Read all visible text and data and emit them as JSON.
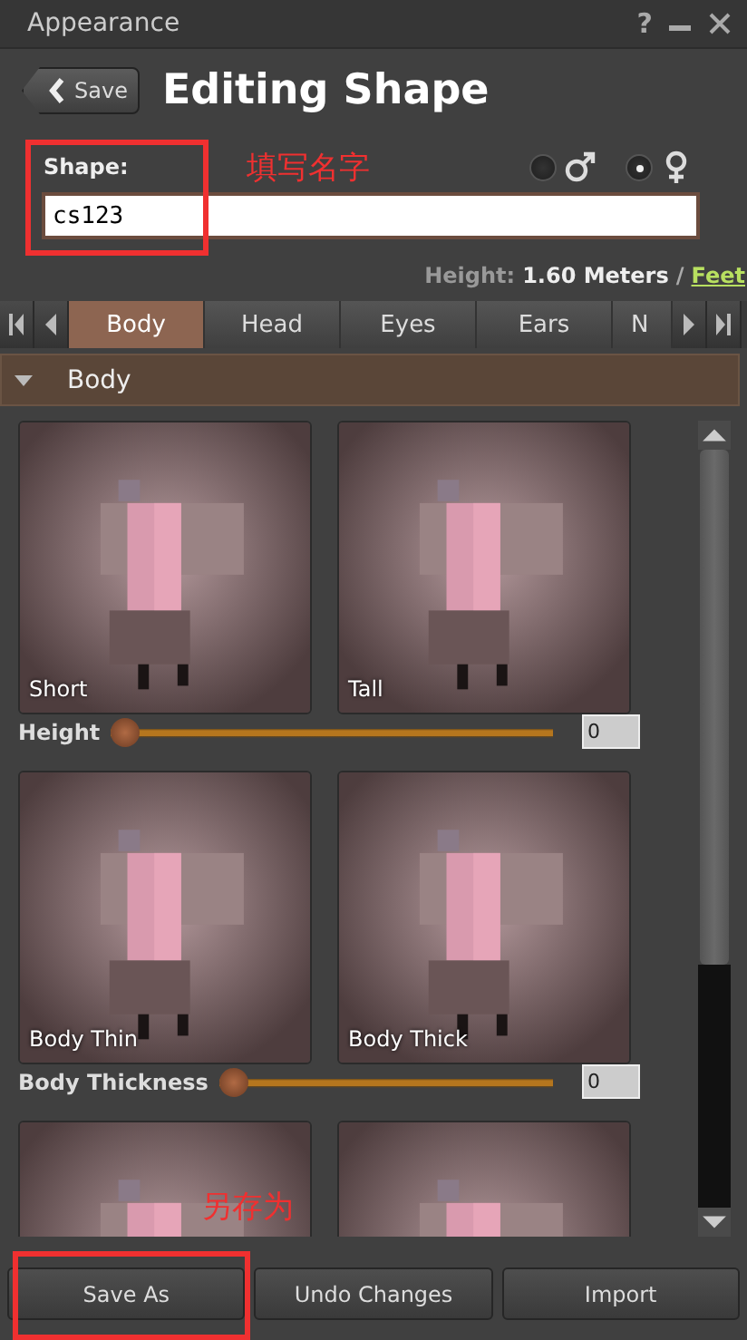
{
  "window": {
    "title": "Appearance",
    "help": "?"
  },
  "header": {
    "back_button": "Save",
    "title": "Editing Shape"
  },
  "shape": {
    "label": "Shape:",
    "value": "cs123"
  },
  "gender": [
    {
      "kind": "male",
      "selected": false
    },
    {
      "kind": "female",
      "selected": true
    }
  ],
  "height_info": {
    "label": "Height:",
    "value": "1.60 Meters",
    "separator": "/",
    "link": "Feet"
  },
  "tabs": [
    {
      "label": "Body",
      "selected": true
    },
    {
      "label": "Head",
      "selected": false
    },
    {
      "label": "Eyes",
      "selected": false
    },
    {
      "label": "Ears",
      "selected": false
    },
    {
      "label": "N",
      "selected": false
    }
  ],
  "section": {
    "title": "Body",
    "expanded": true
  },
  "params": [
    {
      "pictures": [
        {
          "label": "Short"
        },
        {
          "label": "Tall"
        }
      ],
      "name": "Height",
      "level": 0,
      "value": "0"
    },
    {
      "pictures": [
        {
          "label": "Body Thin"
        },
        {
          "label": "Body Thick"
        }
      ],
      "name": "Body Thickness",
      "level": 0,
      "value": "0"
    },
    {
      "pictures": [
        {
          "kind": "picture"
        },
        {
          "kind": "picture"
        }
      ]
    }
  ],
  "buttons": [
    "Save As",
    "Undo Changes",
    "Import"
  ],
  "annotations": [
    {
      "text": "填写名字"
    },
    {
      "text": "另存为"
    }
  ]
}
